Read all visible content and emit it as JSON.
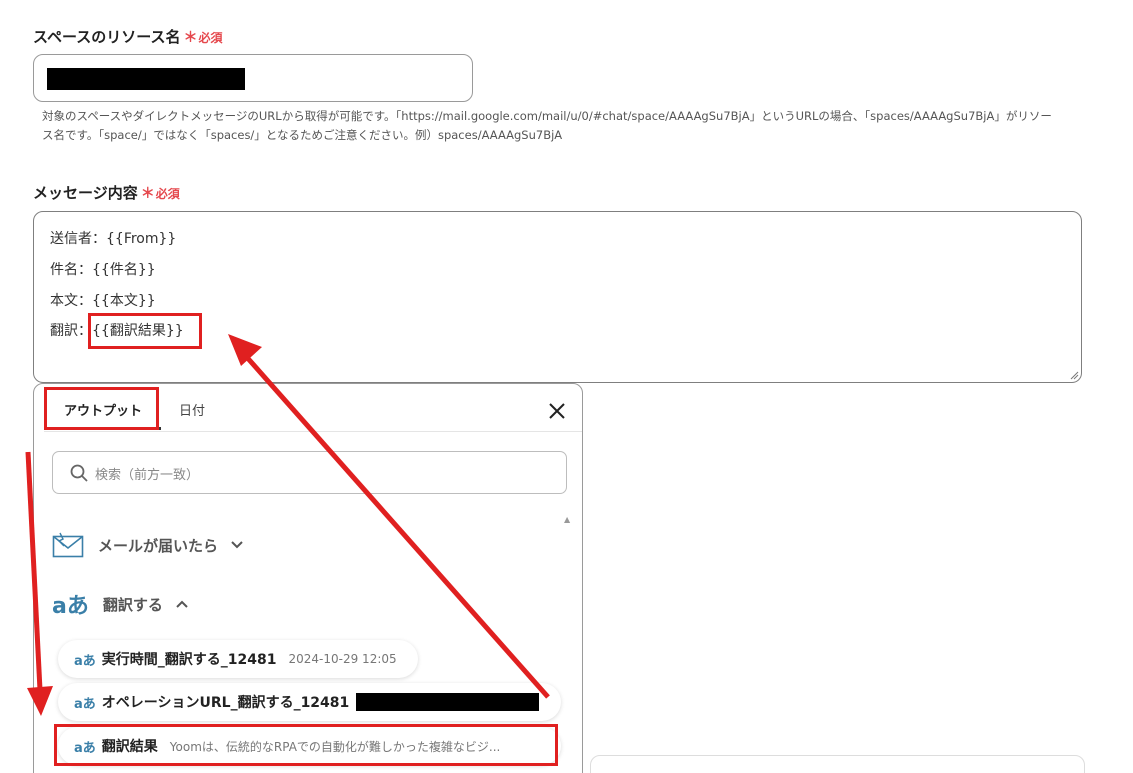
{
  "space_field": {
    "label": "スペースのリソース名",
    "required_mark": "＊",
    "required_text": "必須",
    "help_line1": "対象のスペースやダイレクトメッセージのURLから取得が可能です。「https://mail.google.com/mail/u/0/#chat/space/AAAAgSu7BjA」というURLの場合、「spaces/AAAAgSu7BjA」がリソー",
    "help_line2": "ス名です。「space/」ではなく「spaces/」となるためご注意ください。例）spaces/AAAAgSu7BjA"
  },
  "message_field": {
    "label": "メッセージ内容",
    "required_mark": "＊",
    "required_text": "必須",
    "lines": [
      "送信者：{{From}}",
      "件名：{{件名}}",
      "本文：{{本文}}"
    ],
    "last_prefix": "翻訳：",
    "last_var": "{{翻訳結果}}"
  },
  "popup": {
    "tabs": [
      "アウトプット",
      "日付"
    ],
    "search_placeholder": "検索（前方一致）",
    "sections": [
      {
        "label": "メールが届いたら",
        "icon": "mail-icon",
        "state": "collapsed"
      },
      {
        "label": "翻訳する",
        "icon": "translate-icon",
        "icon_text": "aあ",
        "state": "expanded"
      }
    ],
    "items": [
      {
        "icon_text": "aあ",
        "name": "実行時間_翻訳する_12481",
        "value": "2024-10-29 12:05"
      },
      {
        "icon_text": "aあ",
        "name": "オペレーションURL_翻訳する_12481",
        "value": ""
      },
      {
        "icon_text": "aあ",
        "name": "翻訳結果",
        "value": "Yoomは、伝統的なRPAでの自動化が難しかった複雑なビジ..."
      }
    ]
  },
  "colors": {
    "required": "#e5484d",
    "annotation_red": "#e02020",
    "icon_blue": "#3a7fa8"
  }
}
